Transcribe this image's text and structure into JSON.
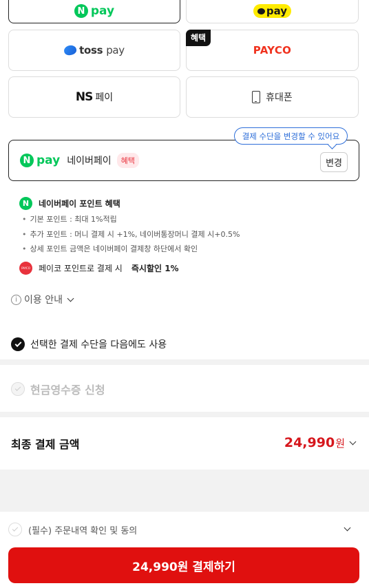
{
  "payment_methods": {
    "naverpay": {
      "logo_letter": "N",
      "logo_text": "pay"
    },
    "kakaopay": {
      "logo_text": "pay"
    },
    "tosspay": {
      "logo_bold": "toss",
      "logo_light": "pay"
    },
    "payco": {
      "label": "PAYCO",
      "badge": "혜택"
    },
    "nspay": {
      "mark": "NS",
      "label": "페이"
    },
    "phone": {
      "label": "휴대폰"
    }
  },
  "selected": {
    "logo_letter": "N",
    "logo_text": "pay",
    "name": "네이버페이",
    "badge": "혜택",
    "change_label": "변경",
    "tooltip": "결제 수단을 변경할 수 있어요"
  },
  "benefits": {
    "title_icon": "N",
    "title": "네이버페이 포인트 혜택",
    "lines": [
      "기본 포인트 : 최대 1%적립",
      "추가 포인트 : 머니 결제 시 +1%, 네이버통장머니 결제 시+0.5%",
      "상세 포인트 금액은 네이버페이 결제창 하단에서 확인"
    ],
    "payco_icon_text": "PAYCO",
    "payco_text": "페이코 포인트로 결제 시",
    "payco_highlight": "즉시할인 1%"
  },
  "info": {
    "icon": "i",
    "label": "이용 안내"
  },
  "reuse": {
    "label": "선택한 결제 수단을 다음에도 사용",
    "checked": true
  },
  "receipt": {
    "label": "현금영수증 신청",
    "checked": false
  },
  "final": {
    "label": "최종 결제 금액",
    "amount": "24,990",
    "unit": "원"
  },
  "agreement": {
    "label": "(필수) 주문내역 확인 및 동의",
    "checked": false
  },
  "pay_button": {
    "label": "24,990원 결제하기"
  },
  "colors": {
    "accent_red": "#e0100f",
    "naver_green": "#03c75a",
    "tooltip_blue": "#2d6ed9",
    "payco_red": "#f0321e"
  }
}
